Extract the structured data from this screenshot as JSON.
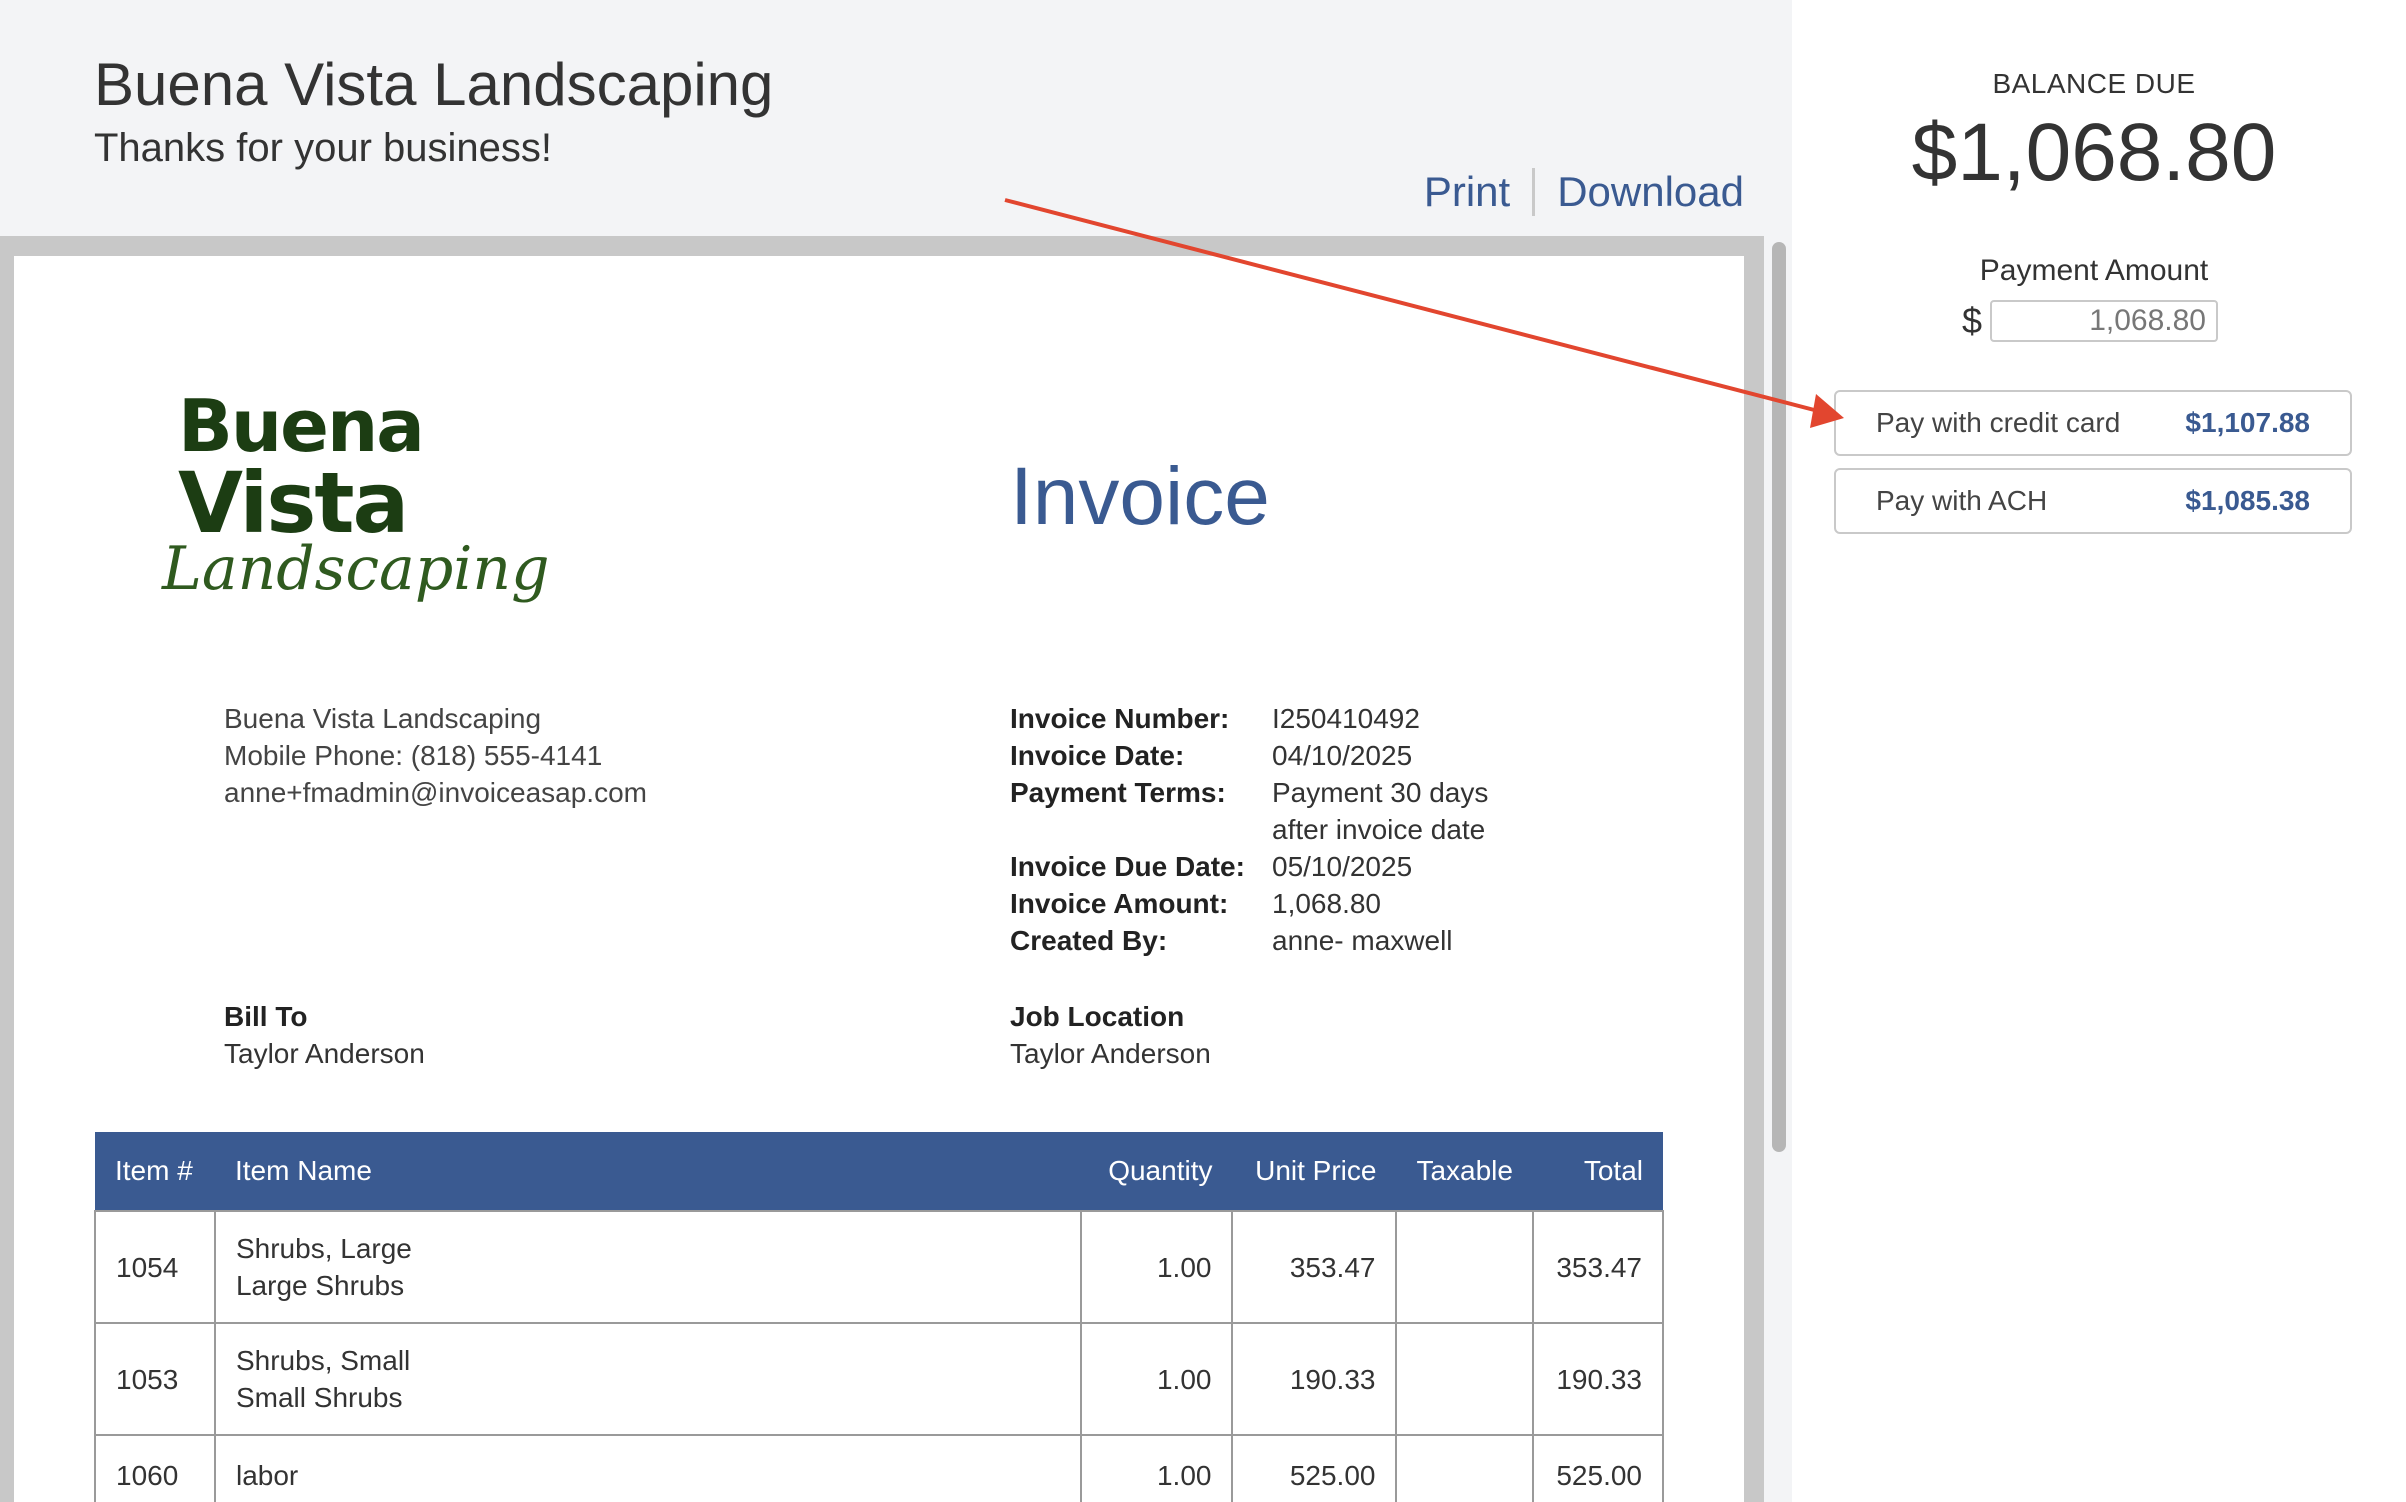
{
  "header": {
    "company_name": "Buena Vista Landscaping",
    "tagline": "Thanks for your business!",
    "print_label": "Print",
    "download_label": "Download"
  },
  "logo": {
    "line1": "Buena",
    "line2": "Vista",
    "script": "Landscaping",
    "color": "#1c3d13"
  },
  "invoice": {
    "heading": "Invoice",
    "from": {
      "name": "Buena Vista Landscaping",
      "phone": "Mobile Phone: (818) 555-4141",
      "email": "anne+fmadmin@invoiceasap.com"
    },
    "meta": [
      {
        "label": "Invoice Number:",
        "value": "I250410492"
      },
      {
        "label": "Invoice Date:",
        "value": "04/10/2025"
      },
      {
        "label": "Payment Terms:",
        "value": "Payment 30 days after invoice date"
      },
      {
        "label": "Invoice Due Date:",
        "value": "05/10/2025"
      },
      {
        "label": "Invoice Amount:",
        "value": "1,068.80"
      },
      {
        "label": "Created By:",
        "value": "anne- maxwell"
      }
    ],
    "bill_to": {
      "heading": "Bill To",
      "name": "Taylor Anderson"
    },
    "job_location": {
      "heading": "Job Location",
      "name": "Taylor Anderson"
    },
    "table": {
      "columns": [
        "Item #",
        "Item Name",
        "Quantity",
        "Unit Price",
        "Taxable",
        "Total"
      ],
      "rows": [
        {
          "item_no": "1054",
          "name": "Shrubs, Large",
          "description": "Large Shrubs",
          "quantity": "1.00",
          "unit_price": "353.47",
          "taxable": "",
          "total": "353.47"
        },
        {
          "item_no": "1053",
          "name": "Shrubs, Small",
          "description": "Small Shrubs",
          "quantity": "1.00",
          "unit_price": "190.33",
          "taxable": "",
          "total": "190.33"
        },
        {
          "item_no": "1060",
          "name": "labor",
          "description": "",
          "quantity": "1.00",
          "unit_price": "525.00",
          "taxable": "",
          "total": "525.00"
        }
      ]
    }
  },
  "payment_panel": {
    "balance_label": "BALANCE DUE",
    "balance_amount": "$1,068.80",
    "payment_amount_label": "Payment Amount",
    "currency_symbol": "$",
    "payment_amount_value": "1,068.80",
    "credit_card": {
      "label": "Pay with credit card",
      "amount": "$1,107.88"
    },
    "ach": {
      "label": "Pay with ACH",
      "amount": "$1,085.38"
    }
  },
  "colors": {
    "accent": "#3a5a91",
    "annotation_arrow": "#e2462f",
    "header_bg": "#f3f4f6"
  }
}
